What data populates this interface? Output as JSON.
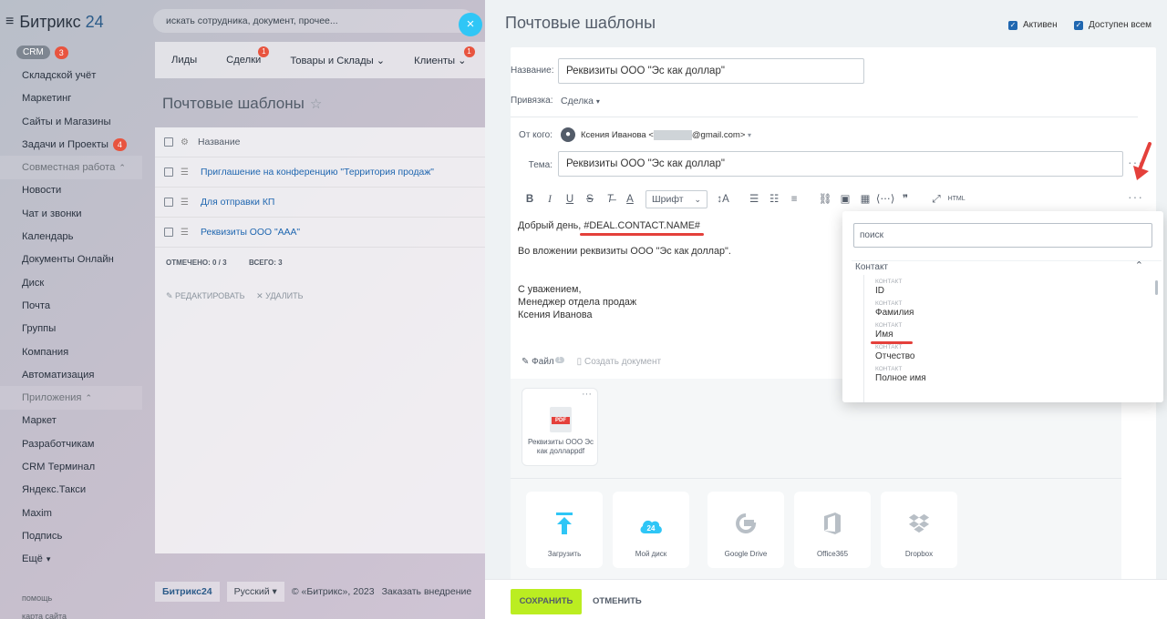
{
  "left_menu": {
    "logo_text": "Битрикс",
    "logo_num": "24",
    "crm_label": "CRM",
    "crm_counter": "3",
    "items": [
      {
        "label": "Складской учёт",
        "counter": "",
        "group": false
      },
      {
        "label": "Маркетинг",
        "counter": "",
        "group": false
      },
      {
        "label": "Сайты и Магазины",
        "counter": "",
        "group": false
      },
      {
        "label": "Задачи и Проекты",
        "counter": "4",
        "group": false
      },
      {
        "label": "Совместная работа",
        "counter": "",
        "group": true
      },
      {
        "label": "Новости",
        "counter": "",
        "group": false
      },
      {
        "label": "Чат и звонки",
        "counter": "",
        "group": false
      },
      {
        "label": "Календарь",
        "counter": "",
        "group": false
      },
      {
        "label": "Документы Онлайн",
        "counter": "",
        "group": false
      },
      {
        "label": "Диск",
        "counter": "",
        "group": false
      },
      {
        "label": "Почта",
        "counter": "",
        "group": false
      },
      {
        "label": "Группы",
        "counter": "",
        "group": false
      },
      {
        "label": "Компания",
        "counter": "",
        "group": false
      },
      {
        "label": "Автоматизация",
        "counter": "",
        "group": false
      },
      {
        "label": "Приложения",
        "counter": "",
        "group": true
      },
      {
        "label": "Маркет",
        "counter": "",
        "group": false
      },
      {
        "label": "Разработчикам",
        "counter": "",
        "group": false
      },
      {
        "label": "CRM Терминал",
        "counter": "",
        "group": false
      },
      {
        "label": "Яндекс.Такси",
        "counter": "",
        "group": false
      },
      {
        "label": "Maxim",
        "counter": "",
        "group": false
      },
      {
        "label": "Подпись",
        "counter": "",
        "group": false
      },
      {
        "label": "Ещё",
        "counter": "",
        "group": false
      }
    ],
    "help": "помощь",
    "map": "карта сайта"
  },
  "top_search_placeholder": "искать сотрудника, документ, прочее...",
  "close_glyph": "×",
  "crm_tabs": [
    {
      "label": "Лиды",
      "badge": ""
    },
    {
      "label": "Сделки",
      "badge": "1"
    },
    {
      "label": "Товары и Склады",
      "badge": ""
    },
    {
      "label": "Клиенты",
      "badge": "1"
    }
  ],
  "bg_page": {
    "title": "Почтовые шаблоны",
    "column_name": "Название",
    "rows": [
      "Приглашение на конференцию \"Территория продаж\"",
      "Для отправки КП",
      "Реквизиты ООО \"ААА\""
    ],
    "selected": "ОТМЕЧЕНО: 0 / 3",
    "total": "ВСЕГО: 3",
    "edit": "РЕДАКТИРОВАТЬ",
    "delete": "УДАЛИТЬ"
  },
  "bg_footer": {
    "logo": "Битрикс24",
    "lang": "Русский",
    "copyright": "© «Битрикс», 2023",
    "order": "Заказать внедрение"
  },
  "slider": {
    "title": "Почтовые шаблоны",
    "active_label": "Активен",
    "public_label": "Доступен всем",
    "name_label": "Название:",
    "name_value": "Реквизиты ООО \"Эс как доллар\"",
    "binding_label": "Привязка:",
    "binding_value": "Сделка",
    "from_label": "От кого:",
    "from_name": "Ксения Иванова <",
    "from_domain": "@gmail.com>",
    "subject_label": "Тема:",
    "subject_value": "Реквизиты ООО \"Эс как доллар\"",
    "font_label": "Шрифт",
    "body_greeting": "Добрый день, ",
    "body_macro": "#DEAL.CONTACT.NAME#",
    "body_line2": "Во вложении реквизиты ООО \"Эс как доллар\".",
    "body_sign1": "С уважением,",
    "body_sign2": "Менеджер отдела продаж",
    "body_sign3": "Ксения Иванова",
    "file_tab": "Файл",
    "file_count": "1",
    "create_doc": "Создать документ",
    "file_name": "Реквизиты ООО Эс как долларpdf",
    "pdf_tag": "PDF",
    "sources": [
      "Загрузить",
      "Мой диск",
      "Google Drive",
      "Office365",
      "Dropbox"
    ],
    "disk_badge": "24",
    "save": "СОХРАНИТЬ",
    "cancel": "ОТМЕНИТЬ"
  },
  "popup": {
    "search_placeholder": "поиск",
    "section": "Контакт",
    "fields": [
      {
        "cat": "КОНТАКТ",
        "label": "ID"
      },
      {
        "cat": "КОНТАКТ",
        "label": "Фамилия"
      },
      {
        "cat": "КОНТАКТ",
        "label": "Имя"
      },
      {
        "cat": "КОНТАКТ",
        "label": "Отчество"
      },
      {
        "cat": "КОНТАКТ",
        "label": "Полное имя"
      }
    ]
  },
  "colors": {
    "accent_blue": "#2067b0",
    "save_green": "#bbed21",
    "annotation_red": "#e4403b",
    "close_cyan": "#2fc6f6"
  }
}
